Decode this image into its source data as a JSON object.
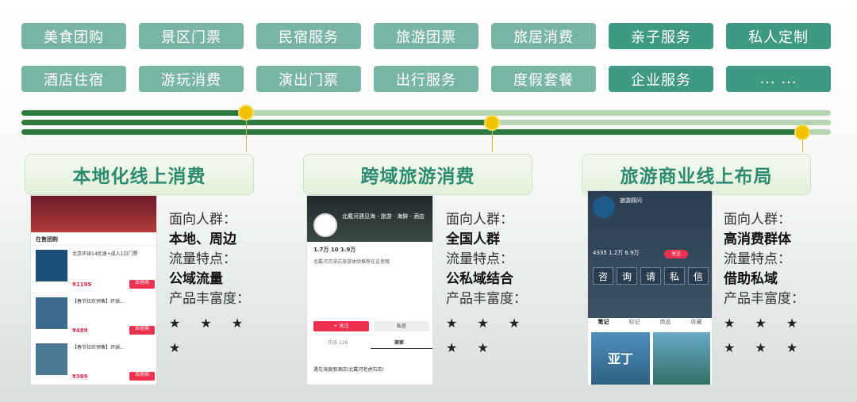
{
  "tags_row1": [
    {
      "label": "美食团购",
      "dark": false
    },
    {
      "label": "景区门票",
      "dark": false
    },
    {
      "label": "民宿服务",
      "dark": false
    },
    {
      "label": "旅游团票",
      "dark": false
    },
    {
      "label": "旅居消费",
      "dark": false
    },
    {
      "label": "亲子服务",
      "dark": true
    },
    {
      "label": "私人定制",
      "dark": true
    }
  ],
  "tags_row2": [
    {
      "label": "酒店住宿",
      "dark": false
    },
    {
      "label": "游玩消费",
      "dark": false
    },
    {
      "label": "演出门票",
      "dark": false
    },
    {
      "label": "出行服务",
      "dark": false
    },
    {
      "label": "度假套餐",
      "dark": false
    },
    {
      "label": "企业服务",
      "dark": true
    },
    {
      "label": "... ...",
      "dark": true
    }
  ],
  "colors": {
    "tag_light": "#79b5a4",
    "tag_dark": "#3f9a83",
    "track": "#2f7a3e",
    "dot": "#f2c200",
    "title": "#2c8b6f"
  },
  "sections": [
    {
      "title": "本地化线上消费",
      "audience_label": "面向人群：",
      "audience": "本地、周边",
      "traffic_label": "流量特点：",
      "traffic": "公域流量",
      "richness_label": "产品丰富度：",
      "stars_line1": "★ ★ ★",
      "stars_line2": "★",
      "rating": 4
    },
    {
      "title": "跨域旅游消费",
      "audience_label": "面向人群：",
      "audience": "全国人群",
      "traffic_label": "流量特点：",
      "traffic": "公私域结合",
      "richness_label": "产品丰富度：",
      "stars_line1": "★ ★ ★",
      "stars_line2": "★ ★",
      "rating": 5
    },
    {
      "title": "旅游商业线上布局",
      "audience_label": "面向人群：",
      "audience": "高消费群体",
      "traffic_label": "流量特点：",
      "traffic": "借助私域",
      "richness_label": "产品丰富度：",
      "stars_line1": "★ ★ ★",
      "stars_line2": "★ ★ ★",
      "rating": 6
    }
  ],
  "phone1": {
    "header": "在售团购",
    "items": [
      {
        "title": "北京环球14优速+成人1日门票",
        "price": "¥1199"
      },
      {
        "title": "【春节狂欢预售】环球...",
        "price": "¥489"
      },
      {
        "title": "【春节狂欢预售】环球...",
        "price": "¥389"
      }
    ],
    "button": "去抢购"
  },
  "phone2": {
    "store": "北戴河遇见海 · 旅游 · 海鲜 · 酒店",
    "stats": "1.7万  10  1.9万",
    "desc": "北戴河沉浸式旅游体验推荐在这里哦",
    "follow": "+ 关注",
    "message": "私信",
    "tab1": "作品 126",
    "tab2": "商家",
    "shop": "遇见海度假酒店(北戴河老虎石店)"
  },
  "phone3": {
    "name": "旅游顾问",
    "stats": "4335  1.2万  6.9万",
    "follow": "关注",
    "chars": [
      "咨",
      "询",
      "请",
      "私",
      "信"
    ],
    "tabs": [
      "笔记",
      "标记",
      "商品",
      "收藏"
    ],
    "promo": "亚丁"
  }
}
